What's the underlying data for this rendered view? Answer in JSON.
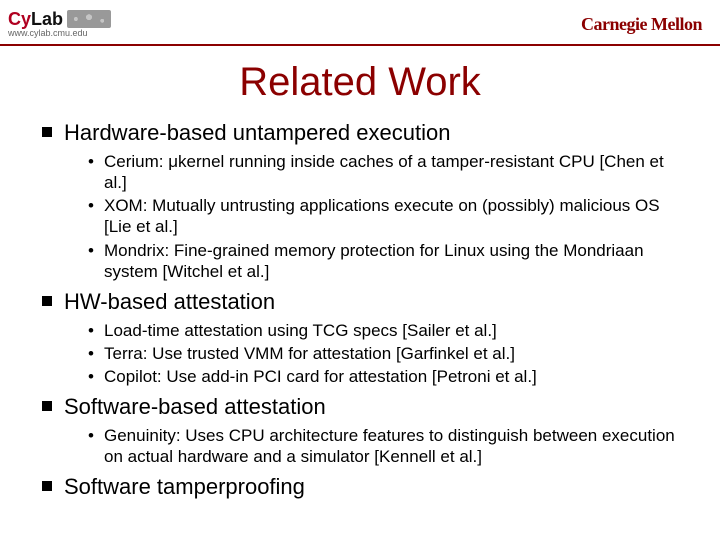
{
  "header": {
    "logo_text_1": "Cy",
    "logo_text_2": "Lab",
    "logo_url": "www.cylab.cmu.edu",
    "right_logo": "Carnegie Mellon"
  },
  "title": "Related Work",
  "sections": [
    {
      "heading": "Hardware-based untampered execution",
      "items": [
        "Cerium: μkernel running inside caches of a tamper-resistant CPU [Chen et al.]",
        "XOM: Mutually untrusting applications execute on (possibly) malicious OS [Lie et al.]",
        "Mondrix: Fine-grained memory protection for Linux using the Mondriaan system [Witchel et al.]"
      ]
    },
    {
      "heading": "HW-based attestation",
      "items": [
        "Load-time attestation using TCG specs [Sailer et al.]",
        "Terra: Use trusted VMM for attestation [Garfinkel et al.]",
        "Copilot: Use add-in PCI card for attestation [Petroni et al.]"
      ]
    },
    {
      "heading": "Software-based attestation",
      "items": [
        "Genuinity: Uses CPU architecture features to distinguish between execution on actual hardware and a simulator [Kennell et al.]"
      ]
    },
    {
      "heading": "Software tamperproofing",
      "items": []
    }
  ]
}
